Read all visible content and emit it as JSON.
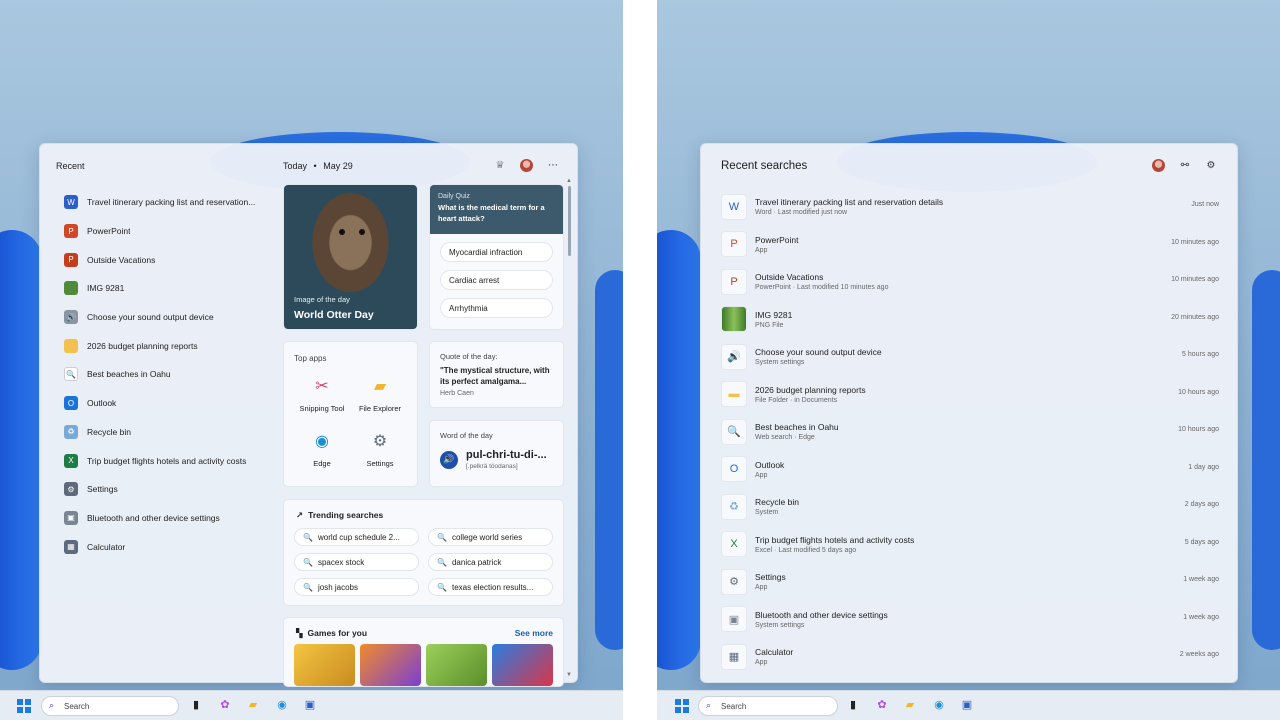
{
  "left": {
    "recent_header": "Recent",
    "recent_items": [
      {
        "label": "Travel itinerary packing list and reservation...",
        "icon": "word-doc-icon",
        "color": "#2b5fc7",
        "glyph": "W"
      },
      {
        "label": "PowerPoint",
        "icon": "powerpoint-icon",
        "color": "#d24726",
        "glyph": "P"
      },
      {
        "label": "Outside Vacations",
        "icon": "powerpoint-file-icon",
        "color": "#c43e1c",
        "glyph": "P"
      },
      {
        "label": "IMG 9281",
        "icon": "image-thumbnail-icon",
        "color": "#4f8a3a",
        "glyph": ""
      },
      {
        "label": "Choose your sound output device",
        "icon": "speaker-icon",
        "color": "#8a94a2",
        "glyph": "🔊"
      },
      {
        "label": "2026 budget planning reports",
        "icon": "folder-icon",
        "color": "#f2c14e",
        "glyph": ""
      },
      {
        "label": "Best beaches in Oahu",
        "icon": "search-icon",
        "color": "#ffffff",
        "glyph": "🔍"
      },
      {
        "label": "Outlook",
        "icon": "outlook-icon",
        "color": "#1a73d9",
        "glyph": "O"
      },
      {
        "label": "Recycle bin",
        "icon": "recycle-bin-icon",
        "color": "#7aa9d9",
        "glyph": "♻"
      },
      {
        "label": "Trip budget flights hotels and activity costs",
        "icon": "excel-icon",
        "color": "#1e7d45",
        "glyph": "X"
      },
      {
        "label": "Settings",
        "icon": "gear-icon",
        "color": "#5f6b7a",
        "glyph": "⚙"
      },
      {
        "label": "Bluetooth and other device settings",
        "icon": "bluetooth-devices-icon",
        "color": "#7a8594",
        "glyph": "▣"
      },
      {
        "label": "Calculator",
        "icon": "calculator-icon",
        "color": "#5b6a7d",
        "glyph": "▦"
      }
    ],
    "today_label": "Today",
    "today_separator": "•",
    "date": "May 29",
    "image_of_day": {
      "kicker": "Image of the day",
      "title": "World Otter Day"
    },
    "quiz": {
      "kicker": "Daily Quiz",
      "question": "What is the medical term for a heart attack?",
      "options": [
        "Myocardial infraction",
        "Cardiac arrest",
        "Arrhythmia"
      ]
    },
    "top_apps": {
      "title": "Top apps",
      "apps": [
        {
          "label": "Snipping Tool",
          "icon": "snipping-tool-icon",
          "glyph": "✂",
          "color": "#d2436b"
        },
        {
          "label": "File Explorer",
          "icon": "file-explorer-icon",
          "glyph": "▰",
          "color": "#f2b62e"
        },
        {
          "label": "Edge",
          "icon": "edge-icon",
          "glyph": "◉",
          "color": "#1c8ed8"
        },
        {
          "label": "Settings",
          "icon": "settings-gear-icon",
          "glyph": "⚙",
          "color": "#5f6b7a"
        }
      ]
    },
    "quote": {
      "title": "Quote of the day:",
      "text": "\"The mystical structure, with its perfect amalgama...",
      "author": "Herb Caen"
    },
    "word_of_day": {
      "title": "Word of the day",
      "word": "pul-chri-tu-di-...",
      "pronunciation": "[.pelkrä töodanas]"
    },
    "trending": {
      "title": "Trending searches",
      "items": [
        "world cup schedule 2...",
        "college world series",
        "spacex stock",
        "danica patrick",
        "josh jacobs",
        "texas election results..."
      ]
    },
    "games": {
      "title": "Games for you",
      "see_more": "See more"
    },
    "taskbar_search": "Search"
  },
  "right": {
    "header": "Recent searches",
    "items": [
      {
        "title": "Travel itinerary packing list and reservation details",
        "subtitle": "Word · Last modified just now",
        "time": "Just now",
        "icon": "word-doc-icon",
        "glyph": "W",
        "color": "#2b5fc7"
      },
      {
        "title": "PowerPoint",
        "subtitle": "App",
        "time": "10 minutes ago",
        "icon": "powerpoint-icon",
        "glyph": "P",
        "color": "#d24726"
      },
      {
        "title": "Outside Vacations",
        "subtitle": "PowerPoint · Last modified 10 minutes ago",
        "time": "10 minutes ago",
        "icon": "powerpoint-file-icon",
        "glyph": "P",
        "color": "#c43e1c"
      },
      {
        "title": "IMG 9281",
        "subtitle": "PNG File",
        "time": "20 minutes ago",
        "icon": "image-thumbnail-icon",
        "glyph": "",
        "color": "#4f8a3a"
      },
      {
        "title": "Choose your sound output device",
        "subtitle": "System settings",
        "time": "5 hours ago",
        "icon": "speaker-icon",
        "glyph": "🔊",
        "color": "#8a94a2"
      },
      {
        "title": "2026 budget planning reports",
        "subtitle": "File Folder · in Documents",
        "time": "10 hours ago",
        "icon": "folder-icon",
        "glyph": "",
        "color": "#f2c14e"
      },
      {
        "title": "Best beaches in Oahu",
        "subtitle": "Web search · Edge",
        "time": "10 hours ago",
        "icon": "search-icon",
        "glyph": "🔍",
        "color": "#ffffff"
      },
      {
        "title": "Outlook",
        "subtitle": "App",
        "time": "1 day ago",
        "icon": "outlook-icon",
        "glyph": "O",
        "color": "#1a73d9"
      },
      {
        "title": "Recycle bin",
        "subtitle": "System",
        "time": "2 days ago",
        "icon": "recycle-bin-icon",
        "glyph": "♻",
        "color": "#7aa9d9"
      },
      {
        "title": "Trip budget flights hotels and activity costs",
        "subtitle": "Excel · Last modified 5 days ago",
        "time": "5 days ago",
        "icon": "excel-icon",
        "glyph": "X",
        "color": "#1e7d45"
      },
      {
        "title": "Settings",
        "subtitle": "App",
        "time": "1 week ago",
        "icon": "gear-icon",
        "glyph": "⚙",
        "color": "#5f6b7a"
      },
      {
        "title": "Bluetooth and other device settings",
        "subtitle": "System settings",
        "time": "1 week ago",
        "icon": "bluetooth-devices-icon",
        "glyph": "▣",
        "color": "#7a8594"
      },
      {
        "title": "Calculator",
        "subtitle": "App",
        "time": "2 weeks ago",
        "icon": "calculator-icon",
        "glyph": "▦",
        "color": "#5b6a7d"
      }
    ],
    "taskbar_search": "Search"
  }
}
